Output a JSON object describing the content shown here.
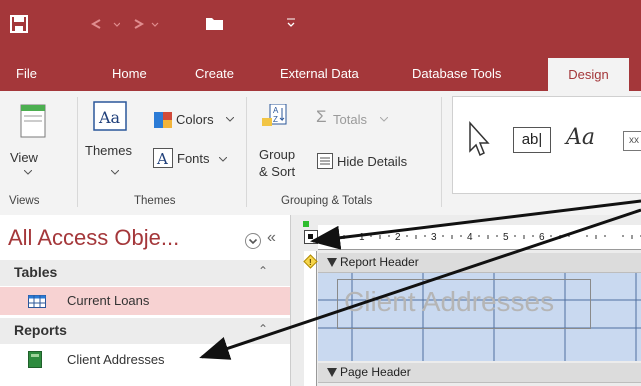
{
  "tabs": [
    "File",
    "Home",
    "Create",
    "External Data",
    "Database Tools",
    "Design"
  ],
  "ribbon": {
    "views_group": {
      "button_label": "View",
      "group_label": "Views"
    },
    "themes_group": {
      "themes_label": "Themes",
      "colors_label": "Colors",
      "fonts_label": "Fonts",
      "group_label": "Themes"
    },
    "grouping_group": {
      "group_sort_label": "Group\n& Sort",
      "totals_label": "Totals",
      "hide_details_label": "Hide Details",
      "group_label": "Grouping & Totals"
    },
    "controls": {
      "textbox_label": "ab|",
      "label_control": "Aa",
      "extra_icon": "xx"
    }
  },
  "nav_pane": {
    "title": "All Access Obje...",
    "sections": [
      {
        "label": "Tables",
        "items": [
          "Current Loans"
        ]
      },
      {
        "label": "Reports",
        "items": [
          "Client Addresses"
        ]
      }
    ]
  },
  "report": {
    "ruler_numbers": [
      "1",
      "2",
      "3",
      "4",
      "5",
      "6"
    ],
    "report_header": "Report Header",
    "title_text": "Client Addresses",
    "page_header": "Page Header"
  },
  "colors": {
    "accent": "#a4373a",
    "selected_item": "#f7d2d2",
    "report_body": "#c9d9f0"
  }
}
